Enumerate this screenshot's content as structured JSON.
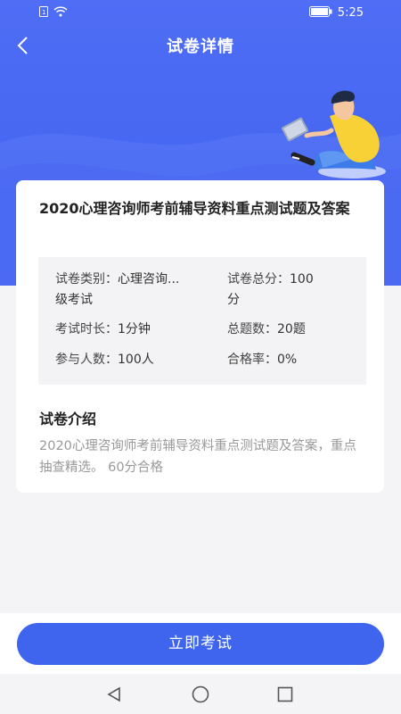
{
  "status": {
    "time": "5:25",
    "icons": [
      "sim-icon",
      "wifi-icon",
      "battery-icon"
    ]
  },
  "nav": {
    "title": "试卷详情",
    "back_icon": "back-chevron-icon"
  },
  "colors": {
    "primary": "#3f65ee",
    "hero": "#4f6df5",
    "intro_text": "#999999"
  },
  "paper": {
    "title": "2020心理咨询师考前辅导资料重点测试题及答案",
    "info": {
      "category_label": "试卷类别：",
      "category_value": "心理咨询...",
      "category_value_line2": "级考试",
      "total_score_label": "试卷总分：",
      "total_score_value": "100",
      "total_score_value_line2": "分",
      "duration_label": "考试时长：",
      "duration_value": "1分钟",
      "question_count_label": "总题数：",
      "question_count_value": "20题",
      "participants_label": "参与人数：",
      "participants_value": "100人",
      "pass_rate_label": "合格率：",
      "pass_rate_value": "0%"
    },
    "intro_title": "试卷介绍",
    "intro_text": "2020心理咨询师考前辅导资料重点测试题及答案，重点抽查精选。 60分合格"
  },
  "actions": {
    "start_label": "立即考试"
  },
  "system_nav": [
    "back-triangle-icon",
    "home-circle-icon",
    "recents-square-icon"
  ]
}
